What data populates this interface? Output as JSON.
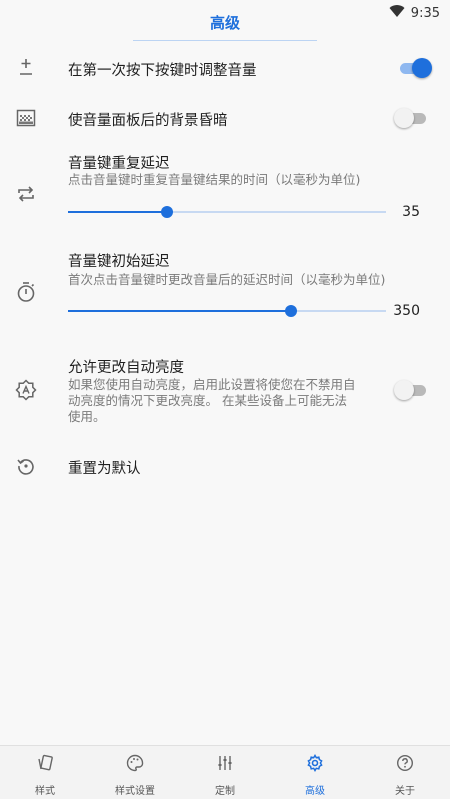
{
  "status": {
    "time": "9:35"
  },
  "header": {
    "title": "高级"
  },
  "settings": {
    "first_press": {
      "title": "在第一次按下按键时调整音量",
      "enabled": true
    },
    "dim_background": {
      "title": "使音量面板后的背景昏暗",
      "enabled": false
    },
    "repeat_delay": {
      "title": "音量键重复延迟",
      "subtitle": "点击音量键时重复音量键结果的时间（以毫秒为单位)",
      "value": "35",
      "fraction": 0.31
    },
    "initial_delay": {
      "title": "音量键初始延迟",
      "subtitle": "首次点击音量键时更改音量后的延迟时间（以毫秒为单位)",
      "value": "350",
      "fraction": 0.7
    },
    "auto_brightness": {
      "title": "允许更改自动亮度",
      "subtitle_line1": "如果您使用自动亮度，启用此设置将使您在不禁用自",
      "subtitle_line2": "动亮度的情况下更改亮度。 在某些设备上可能无法",
      "subtitle_line3": "使用。",
      "enabled": false
    },
    "reset": {
      "title": "重置为默认"
    }
  },
  "bottom_nav": [
    {
      "label": "样式",
      "icon": "style-card-icon",
      "active": false
    },
    {
      "label": "样式设置",
      "icon": "palette-icon",
      "active": false
    },
    {
      "label": "定制",
      "icon": "tune-sliders-icon",
      "active": false
    },
    {
      "label": "高级",
      "icon": "gear-icon",
      "active": true
    },
    {
      "label": "关于",
      "icon": "help-circle-icon",
      "active": false
    }
  ],
  "colors": {
    "accent": "#1e6fdc",
    "text": "#1f1f1f",
    "subtext": "#7a7a7a"
  }
}
